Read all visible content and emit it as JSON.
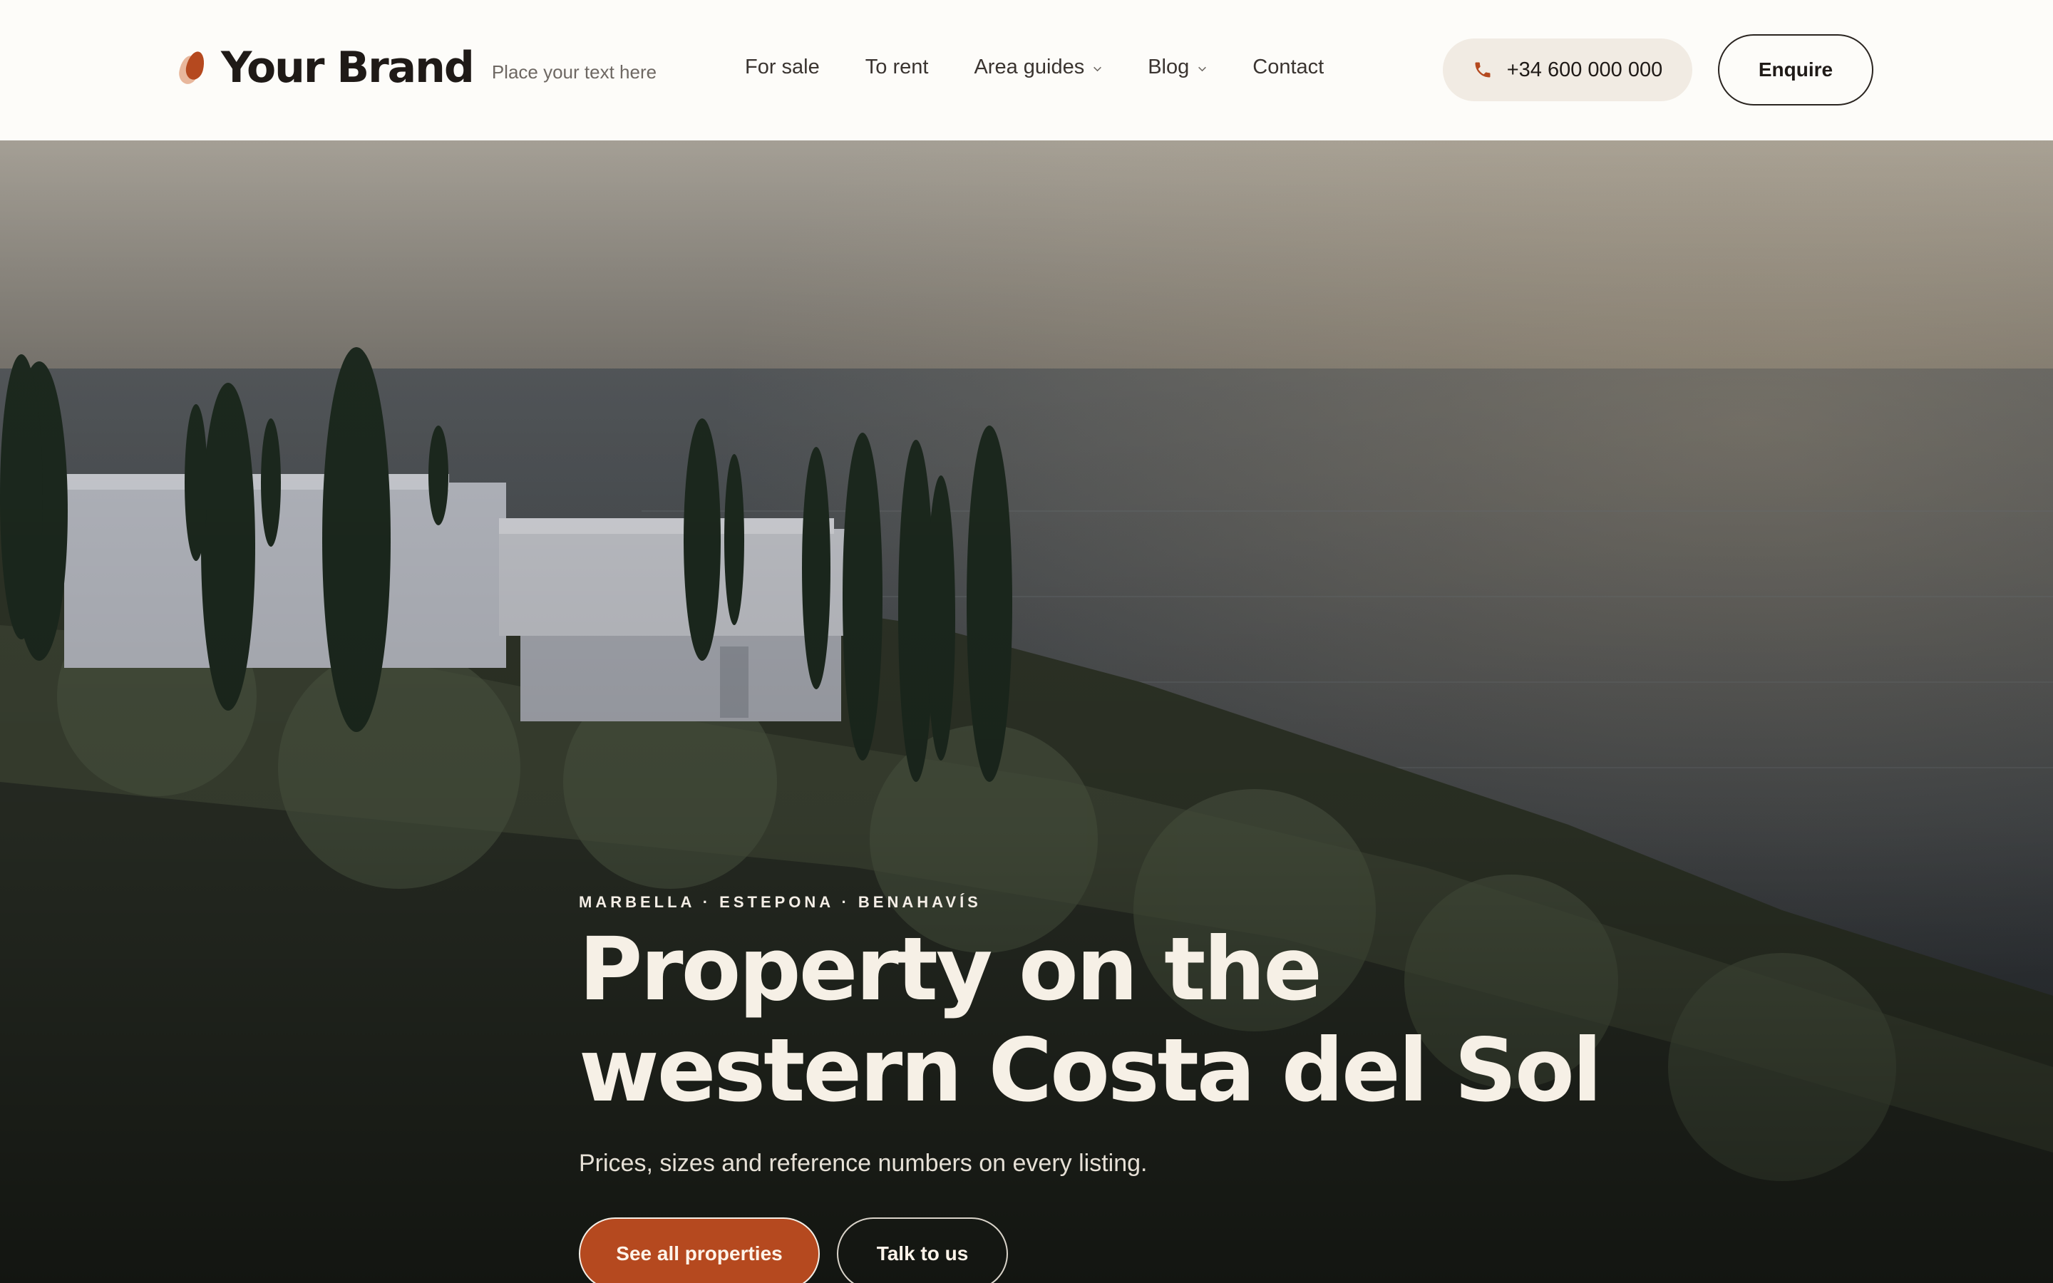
{
  "header": {
    "brand_name": "Your Brand",
    "tagline": "Place your text here",
    "nav": [
      {
        "label": "For sale",
        "has_dropdown": false
      },
      {
        "label": "To rent",
        "has_dropdown": false
      },
      {
        "label": "Area guides",
        "has_dropdown": true
      },
      {
        "label": "Blog",
        "has_dropdown": true
      },
      {
        "label": "Contact",
        "has_dropdown": false
      }
    ],
    "phone": "+34 600 000 000",
    "phone_icon": "phone-icon",
    "enquire_label": "Enquire"
  },
  "hero": {
    "eyebrow": "MARBELLA · ESTEPONA · BENAHAVÍS",
    "title_line1": "Property on the",
    "title_line2": "western Costa del Sol",
    "subtitle": "Prices, sizes and reference numbers on every listing.",
    "primary_cta": "See all properties",
    "secondary_cta": "Talk to us"
  },
  "colors": {
    "accent": "#b5491f",
    "header_bg": "#fdfcf9",
    "phone_pill_bg": "#f1ebe3",
    "text_dark": "#1f1a17",
    "hero_text": "#f6f0e6"
  }
}
